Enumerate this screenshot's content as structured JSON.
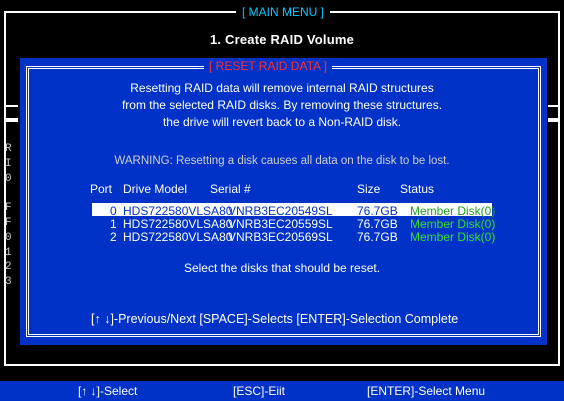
{
  "main_menu": {
    "title": "[ MAIN MENU ]",
    "item1": "1.  Create RAID Volume",
    "side_letters": [
      "R",
      "I",
      "0",
      "",
      "F",
      "F",
      "0",
      "1",
      "2",
      "3"
    ]
  },
  "dialog": {
    "title": "[ RESET RAID DATA ]",
    "line1": "Resetting RAID data will remove internal RAID structures",
    "line2": "from the selected RAID disks. By removing these structures.",
    "line3": "the drive will revert back to a Non-RAID disk.",
    "warning": "WARNING:  Resetting a disk causes all data on the disk to be lost.",
    "columns": {
      "port": "Port",
      "model": "Drive Model",
      "serial": "Serial #",
      "size": "Size",
      "status": "Status"
    },
    "rows": [
      {
        "port": "0",
        "model": "HDS722580VLSA80",
        "serial": "VNRB3EC20549SL",
        "size": "76.7GB",
        "status": "Member Disk(0)"
      },
      {
        "port": "1",
        "model": "HDS722580VLSA80",
        "serial": "VNRB3EC20559SL",
        "size": "76.7GB",
        "status": "Member Disk(0)"
      },
      {
        "port": "2",
        "model": "HDS722580VLSA80",
        "serial": "VNRB3EC20569SL",
        "size": "76.7GB",
        "status": "Member Disk(0)"
      }
    ],
    "select_note": "Select the disks that should be reset.",
    "footer": "[↑ ↓]-Previous/Next   [SPACE]-Selects   [ENTER]-Selection Complete"
  },
  "bottom_bar": {
    "select": "[↑ ↓]-Select",
    "exit": "[ESC]-Eiit",
    "enter": "[ENTER]-Select Menu"
  },
  "colors": {
    "background": "#000000",
    "dialog_blue": "#0032c8",
    "title_red": "#ff3030",
    "menu_title_cyan": "#00c8ff",
    "status_green": "#30e030"
  }
}
